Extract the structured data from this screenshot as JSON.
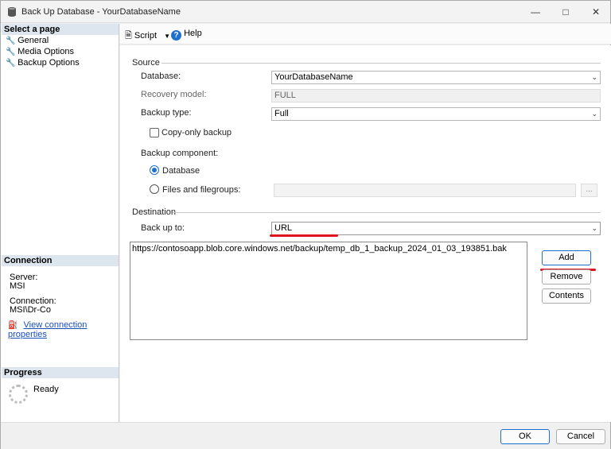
{
  "window": {
    "title": "Back Up Database - YourDatabaseName",
    "scribble": "..."
  },
  "leftpane": {
    "select_page_header": "Select a page",
    "pages": [
      {
        "label": "General"
      },
      {
        "label": "Media Options"
      },
      {
        "label": "Backup Options"
      }
    ],
    "connection_header": "Connection",
    "server_label": "Server:",
    "server_value": "MSI",
    "connection_label": "Connection:",
    "connection_value": "MSI\\Dr-Co",
    "view_link": "View connection properties",
    "progress_header": "Progress",
    "progress_status": "Ready"
  },
  "toolbar": {
    "script_label": "Script",
    "help_label": "Help"
  },
  "source": {
    "group_label": "Source",
    "database_label": "Database:",
    "database_value": "YourDatabaseName",
    "recovery_label": "Recovery model:",
    "recovery_value": "FULL",
    "backup_type_label": "Backup type:",
    "backup_type_value": "Full",
    "copy_only_label": "Copy-only backup",
    "component_label": "Backup component:",
    "component_database": "Database",
    "component_files": "Files and filegroups:",
    "ellipsis": "..."
  },
  "destination": {
    "group_label": "Destination",
    "backup_to_label": "Back up to:",
    "backup_to_value": "URL",
    "list_items": [
      "https://contosoapp.blob.core.windows.net/backup/temp_db_1_backup_2024_01_03_193851.bak"
    ],
    "add_label": "Add",
    "remove_label": "Remove",
    "contents_label": "Contents"
  },
  "footer": {
    "ok_label": "OK",
    "cancel_label": "Cancel"
  },
  "colors": {
    "accent": "#1e6fd0",
    "annotation_red": "#e0141e"
  }
}
